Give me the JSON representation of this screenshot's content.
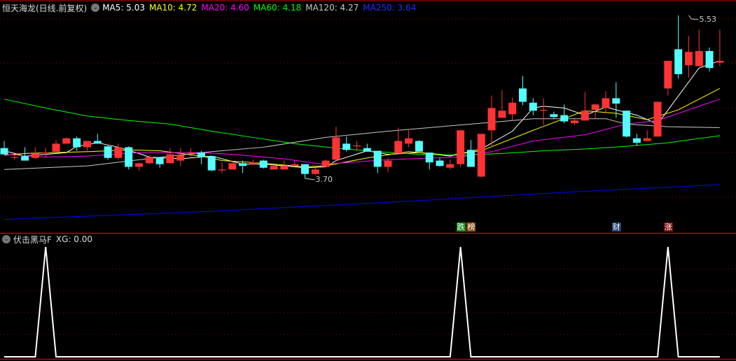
{
  "header": {
    "title": "恒天海龙(日线.前复权)",
    "dropdown_icon": "chevron-down-icon",
    "ma": [
      {
        "label": "MA5: 5.03",
        "color": "#ffffff"
      },
      {
        "label": "MA10: 4.72",
        "color": "#ffff00"
      },
      {
        "label": "MA20: 4.60",
        "color": "#ff00ff"
      },
      {
        "label": "MA60: 4.18",
        "color": "#00ff00"
      },
      {
        "label": "MA120: 4.27",
        "color": "#c8c8c8"
      },
      {
        "label": "MA250: 3.64",
        "color": "#0000ff"
      }
    ]
  },
  "indicator": {
    "title": "伏击黑马F",
    "value_label": "XG: 0.00"
  },
  "markers": [
    {
      "text": "跌",
      "index": 44,
      "color": "#1a8a1a"
    },
    {
      "text": "榜",
      "index": 45,
      "color": "#8a4a10"
    },
    {
      "text": "财",
      "index": 59,
      "color": "#1a3f6e"
    },
    {
      "text": "涨",
      "index": 64,
      "color": "#7a0a0a"
    }
  ],
  "colors": {
    "up": "#ff3333",
    "down": "#54ffff",
    "grid": "#8b0000",
    "divider": "#c00000"
  },
  "chart_data": [
    {
      "type": "candlestick",
      "title": "恒天海龙(日线.前复权)",
      "ylim": [
        3.05,
        5.6
      ],
      "annotations": [
        {
          "text": "5.53",
          "index": 66,
          "value": 5.53
        },
        {
          "text": "3.70",
          "index": 29,
          "value": 3.7
        }
      ],
      "ohlc": [
        [
          4.04,
          4.12,
          3.97,
          3.97
        ],
        [
          3.94,
          3.96,
          3.91,
          3.94
        ],
        [
          3.95,
          4.05,
          3.9,
          3.9
        ],
        [
          3.93,
          4.05,
          3.92,
          3.98
        ],
        [
          3.99,
          4.04,
          3.94,
          3.99
        ],
        [
          4.0,
          4.13,
          4.0,
          4.09
        ],
        [
          4.09,
          4.16,
          4.09,
          4.15
        ],
        [
          4.15,
          4.17,
          4.01,
          4.05
        ],
        [
          4.05,
          4.12,
          4.01,
          4.12
        ],
        [
          4.12,
          4.2,
          4.09,
          4.09
        ],
        [
          4.06,
          4.07,
          3.91,
          3.93
        ],
        [
          3.93,
          4.09,
          3.91,
          4.05
        ],
        [
          4.05,
          4.06,
          3.8,
          3.83
        ],
        [
          3.83,
          3.88,
          3.79,
          3.87
        ],
        [
          3.87,
          3.96,
          3.86,
          3.94
        ],
        [
          3.94,
          3.94,
          3.82,
          3.86
        ],
        [
          3.87,
          4.04,
          3.87,
          3.97
        ],
        [
          3.9,
          4.04,
          3.84,
          3.96
        ],
        [
          3.98,
          4.04,
          3.94,
          3.99
        ],
        [
          3.99,
          4.01,
          3.86,
          3.94
        ],
        [
          3.95,
          3.95,
          3.78,
          3.79
        ],
        [
          3.79,
          3.88,
          3.76,
          3.8
        ],
        [
          3.8,
          3.88,
          3.8,
          3.87
        ],
        [
          3.87,
          3.9,
          3.76,
          3.84
        ],
        [
          3.86,
          3.91,
          3.86,
          3.88
        ],
        [
          3.9,
          3.91,
          3.81,
          3.82
        ],
        [
          3.8,
          3.85,
          3.8,
          3.84
        ],
        [
          3.8,
          3.9,
          3.8,
          3.84
        ],
        [
          3.84,
          3.9,
          3.84,
          3.86
        ],
        [
          3.86,
          3.86,
          3.7,
          3.75
        ],
        [
          3.75,
          3.82,
          3.74,
          3.8
        ],
        [
          3.83,
          3.91,
          3.83,
          3.9
        ],
        [
          3.91,
          4.28,
          3.9,
          4.16
        ],
        [
          4.09,
          4.17,
          4.0,
          4.02
        ],
        [
          4.07,
          4.12,
          4.01,
          4.07
        ],
        [
          4.04,
          4.09,
          4.0,
          4.0
        ],
        [
          4.01,
          4.01,
          3.76,
          3.83
        ],
        [
          3.83,
          3.93,
          3.77,
          3.9
        ],
        [
          3.98,
          4.27,
          3.98,
          4.12
        ],
        [
          4.09,
          4.24,
          4.05,
          4.15
        ],
        [
          4.12,
          4.13,
          4.0,
          4.0
        ],
        [
          3.99,
          3.99,
          3.8,
          3.88
        ],
        [
          3.9,
          3.93,
          3.83,
          3.84
        ],
        [
          3.82,
          3.91,
          3.8,
          3.86
        ],
        [
          3.86,
          4.24,
          3.83,
          4.24
        ],
        [
          4.02,
          4.13,
          3.83,
          3.83
        ],
        [
          3.72,
          4.2,
          3.71,
          4.2
        ],
        [
          4.24,
          4.63,
          4.05,
          4.49
        ],
        [
          4.38,
          4.69,
          4.38,
          4.46
        ],
        [
          4.42,
          4.61,
          4.35,
          4.55
        ],
        [
          4.71,
          4.85,
          4.52,
          4.56
        ],
        [
          4.55,
          4.6,
          4.41,
          4.46
        ],
        [
          4.46,
          4.6,
          4.3,
          4.47
        ],
        [
          4.42,
          4.45,
          4.37,
          4.39
        ],
        [
          4.41,
          4.53,
          4.32,
          4.34
        ],
        [
          4.32,
          4.38,
          4.3,
          4.35
        ],
        [
          4.35,
          4.67,
          4.35,
          4.46
        ],
        [
          4.47,
          4.54,
          4.37,
          4.53
        ],
        [
          4.49,
          4.68,
          4.43,
          4.6
        ],
        [
          4.6,
          4.78,
          4.38,
          4.54
        ],
        [
          4.46,
          4.46,
          4.16,
          4.17
        ],
        [
          4.15,
          4.2,
          4.07,
          4.1
        ],
        [
          4.12,
          4.24,
          4.12,
          4.15
        ],
        [
          4.17,
          4.56,
          4.17,
          4.56
        ],
        [
          4.71,
          5.02,
          4.63,
          5.02
        ],
        [
          5.15,
          5.53,
          4.82,
          4.87
        ],
        [
          4.97,
          5.3,
          4.83,
          5.12
        ],
        [
          4.96,
          5.37,
          4.96,
          5.13
        ],
        [
          5.13,
          5.17,
          4.9,
          4.94
        ],
        [
          5.0,
          5.37,
          4.96,
          5.02
        ]
      ],
      "series": [
        {
          "name": "MA5",
          "color": "#ffffff",
          "points": [
            [
              0,
              4.01
            ],
            [
              2,
              3.95
            ],
            [
              6,
              3.99
            ],
            [
              7,
              4.06
            ],
            [
              9,
              4.1
            ],
            [
              11,
              4.05
            ],
            [
              13,
              3.98
            ],
            [
              14,
              3.94
            ],
            [
              17,
              3.92
            ],
            [
              20,
              3.95
            ],
            [
              23,
              3.86
            ],
            [
              25,
              3.86
            ],
            [
              29,
              3.82
            ],
            [
              31,
              3.83
            ],
            [
              32,
              3.9
            ],
            [
              35,
              4.01
            ],
            [
              37,
              3.97
            ],
            [
              40,
              3.99
            ],
            [
              43,
              3.95
            ],
            [
              46,
              4.03
            ],
            [
              49,
              4.23
            ],
            [
              51,
              4.49
            ],
            [
              52,
              4.51
            ],
            [
              54,
              4.49
            ],
            [
              56,
              4.41
            ],
            [
              58,
              4.5
            ],
            [
              61,
              4.41
            ],
            [
              63,
              4.31
            ],
            [
              67,
              4.94
            ],
            [
              69,
              5.02
            ]
          ]
        },
        {
          "name": "MA10",
          "color": "#ffff00",
          "points": [
            [
              0,
              3.96
            ],
            [
              2,
              3.98
            ],
            [
              8,
              4.0
            ],
            [
              12,
              4.02
            ],
            [
              15,
              4.01
            ],
            [
              19,
              3.95
            ],
            [
              21,
              3.9
            ],
            [
              25,
              3.87
            ],
            [
              29,
              3.83
            ],
            [
              31,
              3.84
            ],
            [
              35,
              3.93
            ],
            [
              39,
              4.0
            ],
            [
              43,
              3.96
            ],
            [
              46,
              4.01
            ],
            [
              51,
              4.24
            ],
            [
              56,
              4.46
            ],
            [
              59,
              4.43
            ],
            [
              62,
              4.36
            ],
            [
              65,
              4.47
            ],
            [
              69,
              4.71
            ]
          ]
        },
        {
          "name": "MA20",
          "color": "#ff00ff",
          "points": [
            [
              0,
              3.97
            ],
            [
              4,
              3.94
            ],
            [
              8,
              3.95
            ],
            [
              13,
              3.99
            ],
            [
              19,
              3.99
            ],
            [
              22,
              3.97
            ],
            [
              27,
              3.92
            ],
            [
              30,
              3.87
            ],
            [
              31,
              3.86
            ],
            [
              37,
              3.91
            ],
            [
              44,
              3.94
            ],
            [
              47,
              4.0
            ],
            [
              51,
              4.12
            ],
            [
              56,
              4.19
            ],
            [
              60,
              4.31
            ],
            [
              63,
              4.35
            ],
            [
              69,
              4.59
            ]
          ]
        },
        {
          "name": "MA60",
          "color": "#00ff00",
          "points": [
            [
              0,
              4.59
            ],
            [
              4,
              4.49
            ],
            [
              8,
              4.4
            ],
            [
              12,
              4.35
            ],
            [
              16,
              4.31
            ],
            [
              20,
              4.23
            ],
            [
              24,
              4.16
            ],
            [
              28,
              4.09
            ],
            [
              32,
              4.04
            ],
            [
              36,
              4.0
            ],
            [
              40,
              3.97
            ],
            [
              44,
              3.96
            ],
            [
              48,
              3.98
            ],
            [
              52,
              4.01
            ],
            [
              56,
              4.03
            ],
            [
              60,
              4.06
            ],
            [
              64,
              4.1
            ],
            [
              69,
              4.18
            ]
          ]
        },
        {
          "name": "MA120",
          "color": "#c8c8c8",
          "points": [
            [
              0,
              3.8
            ],
            [
              8,
              3.84
            ],
            [
              16,
              3.95
            ],
            [
              20,
              4.0
            ],
            [
              25,
              4.05
            ],
            [
              31,
              4.16
            ],
            [
              37,
              4.23
            ],
            [
              44,
              4.3
            ],
            [
              51,
              4.37
            ],
            [
              58,
              4.37
            ],
            [
              60,
              4.31
            ],
            [
              64,
              4.28
            ],
            [
              69,
              4.27
            ]
          ]
        },
        {
          "name": "MA250",
          "color": "#0000ff",
          "points": [
            [
              0,
              3.24
            ],
            [
              20,
              3.33
            ],
            [
              40,
              3.45
            ],
            [
              55,
              3.55
            ],
            [
              69,
              3.63
            ]
          ]
        }
      ]
    },
    {
      "type": "line",
      "title": "伏击黑马F",
      "ylim": [
        0,
        1
      ],
      "series": [
        {
          "name": "XG",
          "color": "#ffffff",
          "values_nonzero": [
            [
              4,
              1
            ],
            [
              44,
              1
            ],
            [
              64,
              1
            ]
          ],
          "count": 70
        }
      ]
    }
  ]
}
